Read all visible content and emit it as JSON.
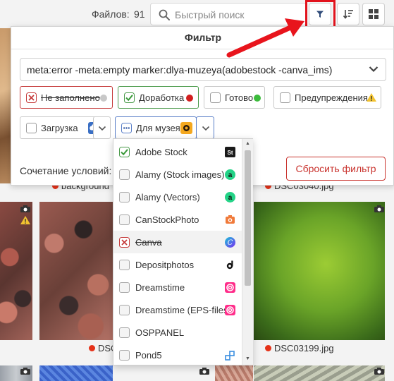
{
  "topbar": {
    "files_label": "Файлов:",
    "files_count": "91",
    "search_placeholder": "Быстрый поиск"
  },
  "icons": [
    "search-icon",
    "filter-icon",
    "sort-icon",
    "grid-icon",
    "camera-icon",
    "warning-icon",
    "chevron-down-icon"
  ],
  "colors": {
    "accent_red": "#e2131d",
    "status_error": "#d23b2c",
    "status_ok": "#3cbb3c",
    "warning": "#f2c230",
    "link_blue": "#3a6fc4"
  },
  "filter": {
    "title": "Фильтр",
    "query": "meta:error -meta:empty marker:dlya-muzeya(adobestock -canva_ims)",
    "chips": {
      "not_filled": "Не заполнено",
      "rework": "Доработка",
      "ready": "Готово",
      "warnings": "Предупреждения",
      "upload": "Загрузка",
      "museum": "Для музея"
    },
    "combine_label": "Сочетание условий:",
    "reset_label": "Сбросить фильтр"
  },
  "dropdown": {
    "items": [
      {
        "label": "Adobe Stock",
        "state": "checked"
      },
      {
        "label": "Alamy (Stock images)",
        "state": "none"
      },
      {
        "label": "Alamy (Vectors)",
        "state": "none"
      },
      {
        "label": "CanStockPhoto",
        "state": "none"
      },
      {
        "label": "Canva",
        "state": "excluded"
      },
      {
        "label": "Depositphotos",
        "state": "none"
      },
      {
        "label": "Dreamstime",
        "state": "none"
      },
      {
        "label": "Dreamstime (EPS-files)",
        "state": "none"
      },
      {
        "label": "OSPPANEL",
        "state": "none"
      },
      {
        "label": "Pond5",
        "state": "none"
      }
    ]
  },
  "captions": {
    "left_mid": "DSC",
    "right_mid": "DSC03199.jpg",
    "top_left": "background",
    "top_right": "DSC03040.jpg"
  }
}
